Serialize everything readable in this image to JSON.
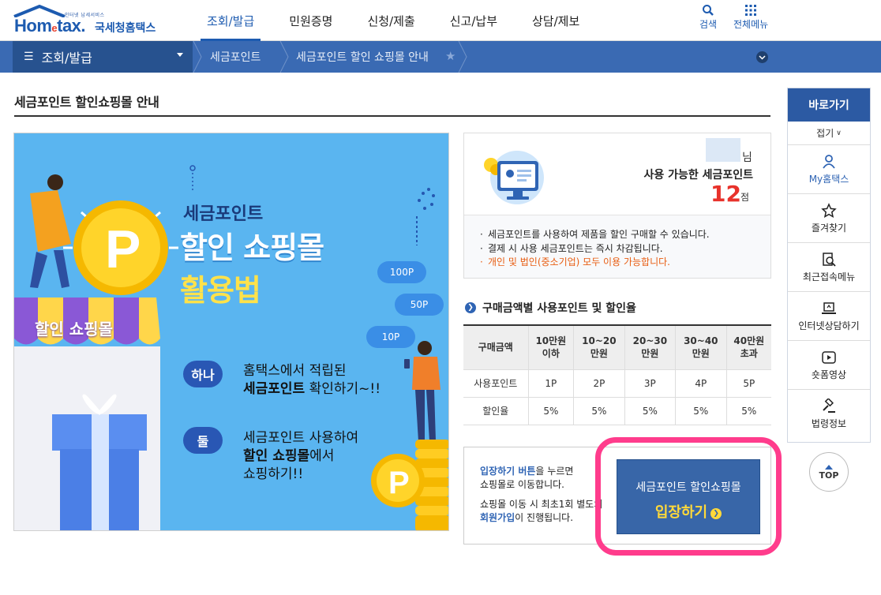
{
  "logo": {
    "small": "인터넷 납세서비스",
    "brand": "Hom",
    "brand_e": "e",
    "brand_rest": "tax.",
    "korean": "국세청홈택스"
  },
  "gnb": [
    "조회/발급",
    "민원증명",
    "신청/제출",
    "신고/납부",
    "상담/제보"
  ],
  "util": {
    "search": "검색",
    "all_menu": "전체메뉴"
  },
  "location": {
    "menu": "조회/발급",
    "crumb1": "세금포인트",
    "crumb2": "세금포인트 할인 쇼핑몰 안내"
  },
  "page_title": "세금포인트 할인쇼핑몰 안내",
  "banner": {
    "title_small": "세금포인트",
    "title_big1": "할인 쇼핑몰",
    "title_big2": "활용법",
    "step1_pill": "하나",
    "step1_line1": "홈택스에서 적립된",
    "step1_bold": "세금포인트",
    "step1_rest": " 확인하기~!!",
    "step2_pill": "둘",
    "step2_line1": "세금포인트 사용하여",
    "step2_bold": "할인 쇼핑몰",
    "step2_rest": "에서",
    "step2_line3": "쇼핑하기!!",
    "shop_label": "할인 쇼핑몰",
    "bubble1": "100P",
    "bubble2": "50P",
    "bubble3": "10P",
    "coin_letter": "P"
  },
  "points": {
    "suffix": "님",
    "available_label": "사용 가능한 세금포인트",
    "value": "12",
    "unit": "점",
    "note1": "세금포인트를 사용하여 제품을 할인 구매할 수 있습니다.",
    "note2": "결제 시 사용 세금포인트는 즉시 차감됩니다.",
    "note3": "개인 및 법인(중소기업) 모두 이용 가능합니다."
  },
  "rate_table": {
    "title": "구매금액별 사용포인트 및 할인율",
    "headers": [
      [
        "구매금액",
        ""
      ],
      [
        "10만원",
        "이하"
      ],
      [
        "10~20",
        "만원"
      ],
      [
        "20~30",
        "만원"
      ],
      [
        "30~40",
        "만원"
      ],
      [
        "40만원",
        "초과"
      ]
    ],
    "rows": [
      [
        "사용포인트",
        "1P",
        "2P",
        "3P",
        "4P",
        "5P"
      ],
      [
        "할인율",
        "5%",
        "5%",
        "5%",
        "5%",
        "5%"
      ]
    ]
  },
  "enter": {
    "text_blue": "입장하기 버튼",
    "text1_rest": "을 누르면",
    "text2": "쇼핑몰로 이동합니다.",
    "text3": "쇼핑몰 이동 시 최초1회 별도의",
    "text4_blue": "회원가입",
    "text4_rest": "이 진행됩니다.",
    "button_line1": "세금포인트 할인쇼핑몰",
    "button_line2": "입장하기"
  },
  "quick": {
    "head": "바로가기",
    "fold": "접기",
    "items": [
      "My홈택스",
      "즐겨찾기",
      "최근접속메뉴",
      "인터넷상담하기",
      "숏폼영상",
      "법령정보"
    ],
    "top": "TOP"
  },
  "colors": {
    "primary": "#2c5aa3",
    "highlight": "#ff3c8c",
    "point": "#e8322b",
    "banner_bg": "#5ab5f0"
  }
}
